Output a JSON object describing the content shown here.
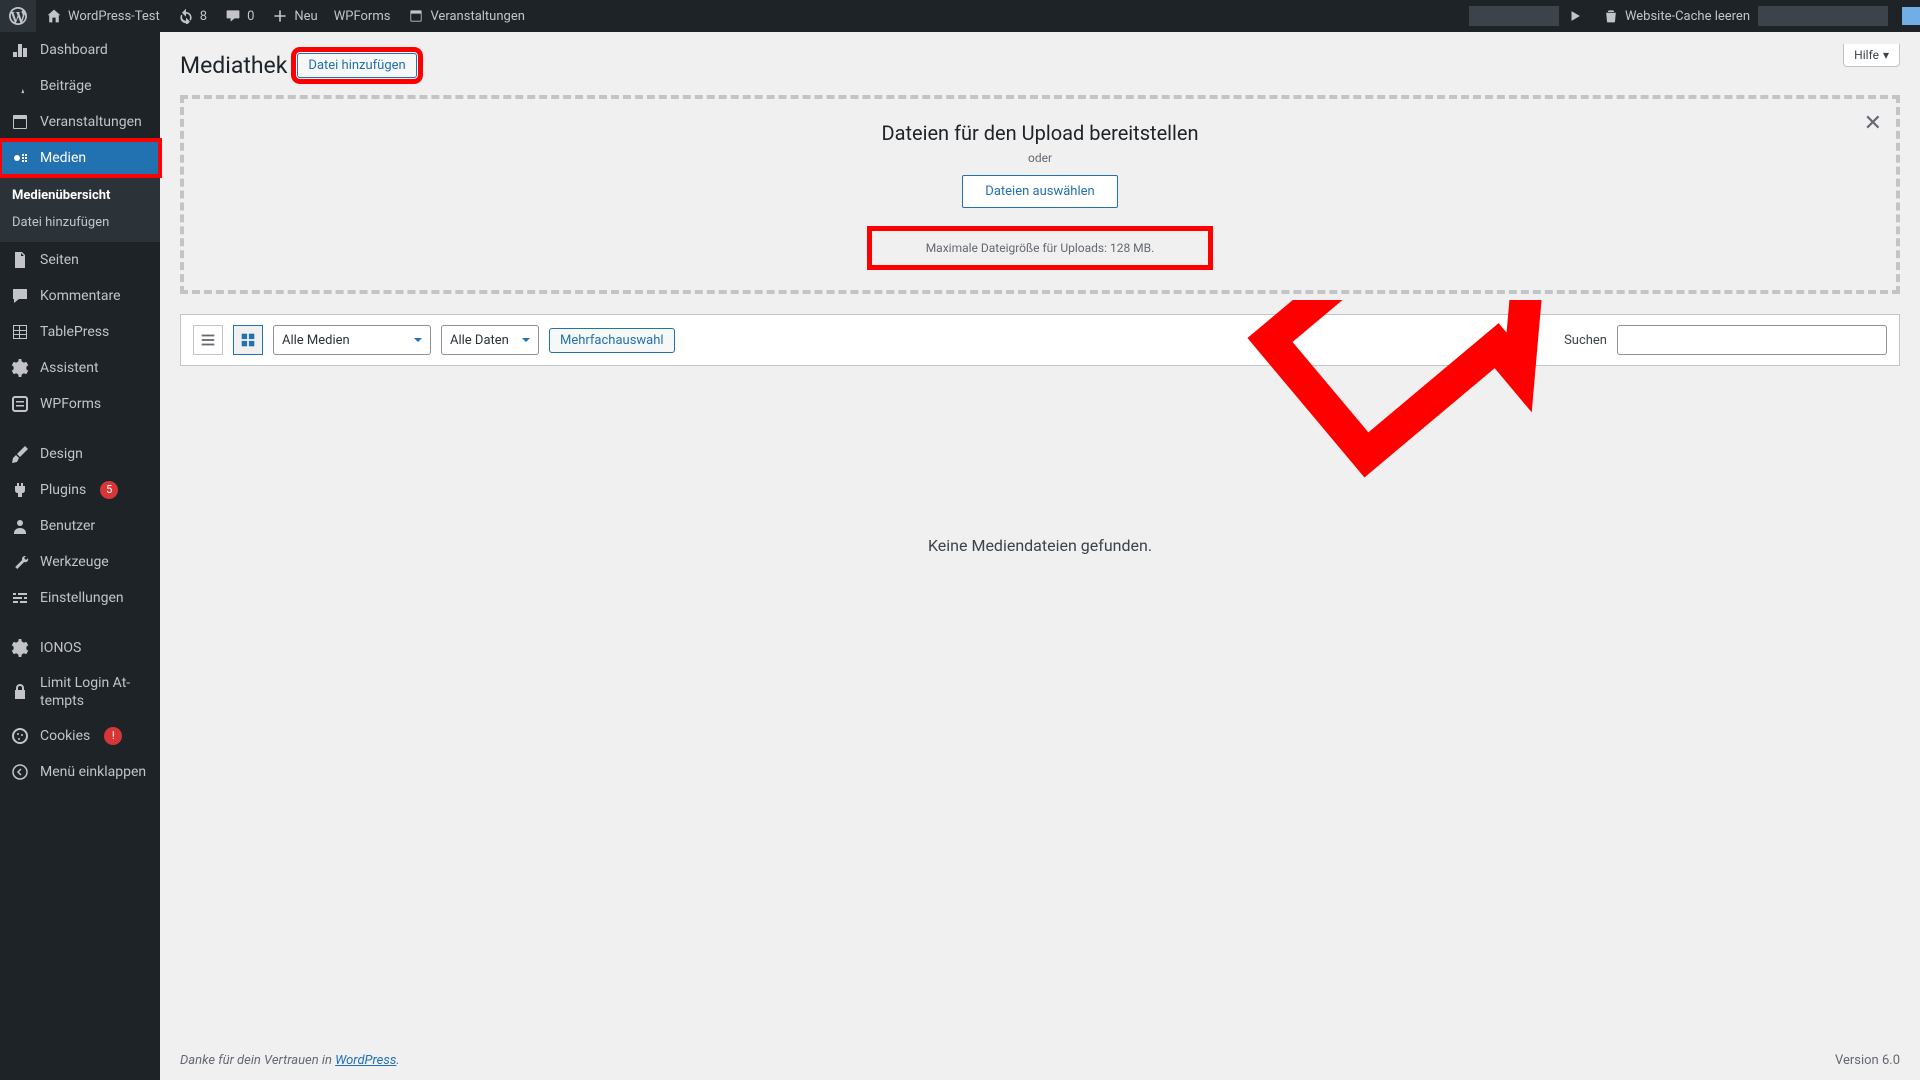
{
  "adminbar": {
    "site_name": "WordPress-Test",
    "updates_count": "8",
    "comments_count": "0",
    "new_label": "Neu",
    "wpforms_label": "WPForms",
    "events_label": "Veranstaltungen",
    "cache_label": "Website-Cache leeren"
  },
  "sidebar": {
    "dashboard": "Dashboard",
    "posts": "Beiträge",
    "events": "Veranstaltungen",
    "media": "Medien",
    "media_sub_overview": "Medienübersicht",
    "media_sub_add": "Datei hinzufügen",
    "pages": "Seiten",
    "comments": "Kommentare",
    "tablepress": "TablePress",
    "assistant": "Assistent",
    "wpforms": "WPForms",
    "design": "Design",
    "plugins": "Plugins",
    "plugins_badge": "5",
    "users": "Benutzer",
    "tools": "Werkzeuge",
    "settings": "Einstellungen",
    "ionos": "IONOS",
    "limit_login": "Limit Login At-tempts",
    "cookies": "Cookies",
    "cookies_badge": "!",
    "collapse": "Menü einklappen"
  },
  "page": {
    "title": "Mediathek",
    "add_file_btn": "Datei hinzufügen",
    "help": "Hilfe"
  },
  "dropzone": {
    "heading": "Dateien für den Upload bereitstellen",
    "or": "oder",
    "select_btn": "Dateien auswählen",
    "max_size": "Maximale Dateigröße für Uploads: 128 MB."
  },
  "toolbar": {
    "filter_media": "Alle Medien",
    "filter_date": "Alle Daten",
    "bulk_select": "Mehrfachauswahl",
    "search_label": "Suchen"
  },
  "empty_message": "Keine Mediendateien gefunden.",
  "footer": {
    "thanks_prefix": "Danke für dein Vertrauen in ",
    "thanks_link": "WordPress",
    "version": "Version 6.0"
  }
}
